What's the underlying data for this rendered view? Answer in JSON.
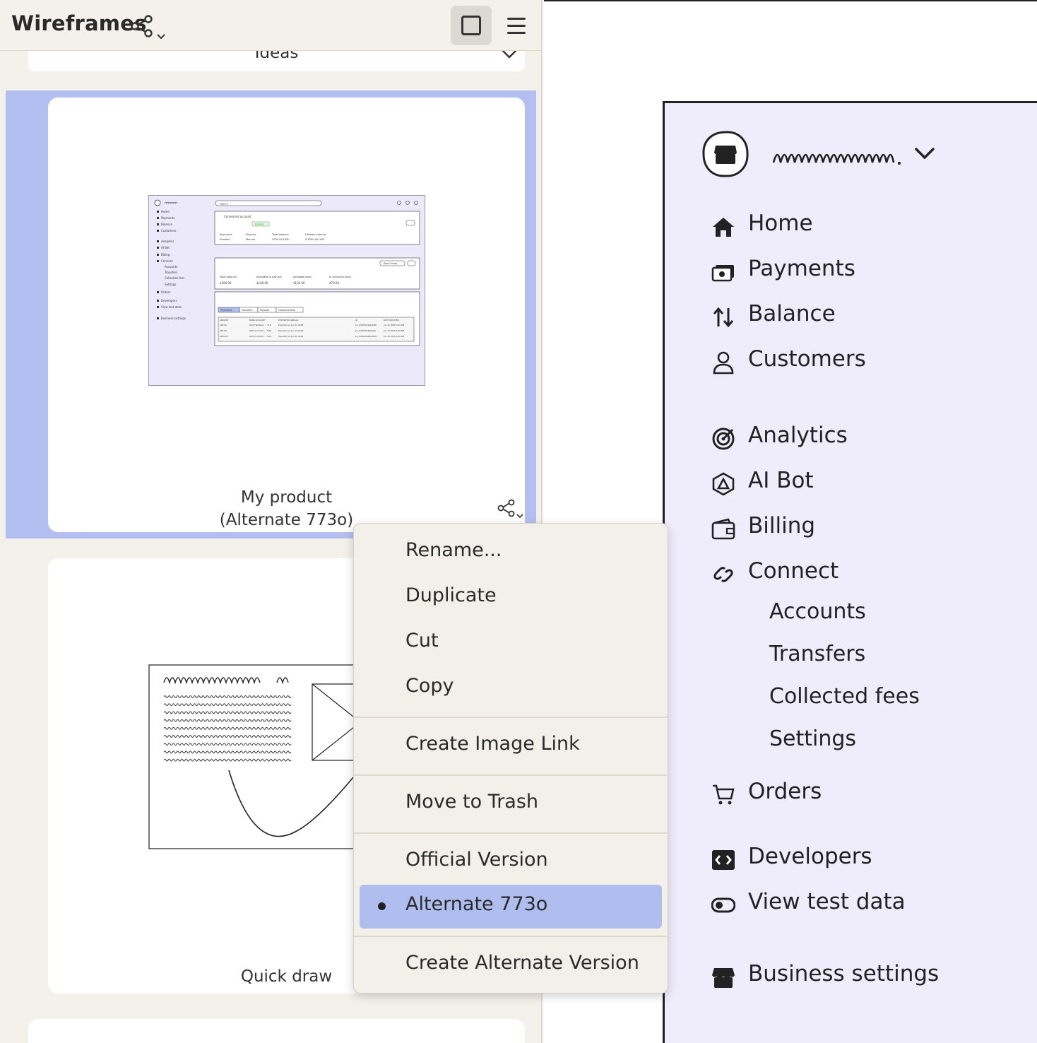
{
  "header": {
    "title": "Wireframes",
    "share_icon": "share-icon",
    "view_toggle_icon": "square-icon",
    "menu_icon": "hamburger-icon"
  },
  "section_dropdown": {
    "label": "Ideas"
  },
  "cards": [
    {
      "title_line1": "My product",
      "title_line2": "(Alternate 773o)",
      "selected": true
    },
    {
      "title": "Quick draw"
    }
  ],
  "context_menu": {
    "items": [
      {
        "label": "Rename..."
      },
      {
        "label": "Duplicate"
      },
      {
        "label": "Cut"
      },
      {
        "label": "Copy"
      },
      {
        "label": "Create Image Link"
      },
      {
        "label": "Move to Trash"
      },
      {
        "label": "Official Version"
      },
      {
        "label": "Alternate 773o",
        "checked": true
      },
      {
        "label": "Create Alternate Version"
      }
    ]
  },
  "wireframe": {
    "nav": [
      {
        "label": "Home",
        "icon": "home-icon"
      },
      {
        "label": "Payments",
        "icon": "payments-icon"
      },
      {
        "label": "Balance",
        "icon": "balance-icon"
      },
      {
        "label": "Customers",
        "icon": "person-icon"
      },
      {
        "label": "Analytics",
        "icon": "target-icon"
      },
      {
        "label": "AI Bot",
        "icon": "ai-bot-icon"
      },
      {
        "label": "Billing",
        "icon": "wallet-icon"
      },
      {
        "label": "Connect",
        "icon": "link-icon"
      },
      {
        "label": "Orders",
        "icon": "cart-icon"
      },
      {
        "label": "Developers",
        "icon": "code-icon"
      },
      {
        "label": "View test data",
        "icon": "toggle-icon"
      },
      {
        "label": "Business settings",
        "icon": "store-icon"
      }
    ],
    "connect_sub": [
      "Accounts",
      "Transfers",
      "Collected fees",
      "Settings"
    ]
  },
  "thumbnail": {
    "nav": [
      "Home",
      "Payments",
      "Balance",
      "Customers",
      "Analytics",
      "AI Bot",
      "Billing",
      "Connect",
      "Accounts",
      "Transfers",
      "Collected fees",
      "Settings",
      "Orders",
      "Developers",
      "View test data",
      "Business settings"
    ],
    "search": "search",
    "connected_account": "Connected account",
    "enabled_badge": "Enabled",
    "stats1": [
      {
        "label": "Payments",
        "value": "Enabled"
      },
      {
        "label": "Payouts",
        "value": "Manual"
      },
      {
        "label": "Total balance",
        "value": "$750.00 USD"
      },
      {
        "label": "Lifetime volume",
        "value": "$ 3500.00 USD"
      }
    ],
    "send_funds": "Send funds",
    "stats2": [
      {
        "label": "Total balance",
        "value": "$300.00"
      },
      {
        "label": "Available to pay out",
        "value": "$100.00"
      },
      {
        "label": "Available soon",
        "value": "$130.00"
      },
      {
        "label": "In transit to bank",
        "value": "$70.00"
      }
    ],
    "tabs": [
      "Payments",
      "Transfers",
      "Payouts",
      "Collected fees"
    ],
    "table_headers": [
      "AMOUNT",
      "BANK ACCOUNT",
      "ESTIMATED ARRIVAL",
      "ID",
      "DATE INITIATED"
    ],
    "rows": [
      [
        "$30.00",
        "GCD Flatsbank ... 718",
        "Expected on Jun 15 2018",
        "po_1H2K3K2K3J2KJ3K",
        "Jun 10 2018 3:40 PM"
      ],
      [
        "$67.00",
        "GCD Unicredit ... 7431",
        "Expected on Jun 16 2018",
        "po_1H2K3K5K2KJ2KJ",
        "Jun 10 2018 3:40 PM"
      ],
      [
        "$150.00",
        "GCD Unicredit ... 7431",
        "Expected on Jun 20 2018",
        "po_1H2K4K4K5K3K2K",
        "Jun 10 2018 3:40 PM"
      ]
    ]
  }
}
